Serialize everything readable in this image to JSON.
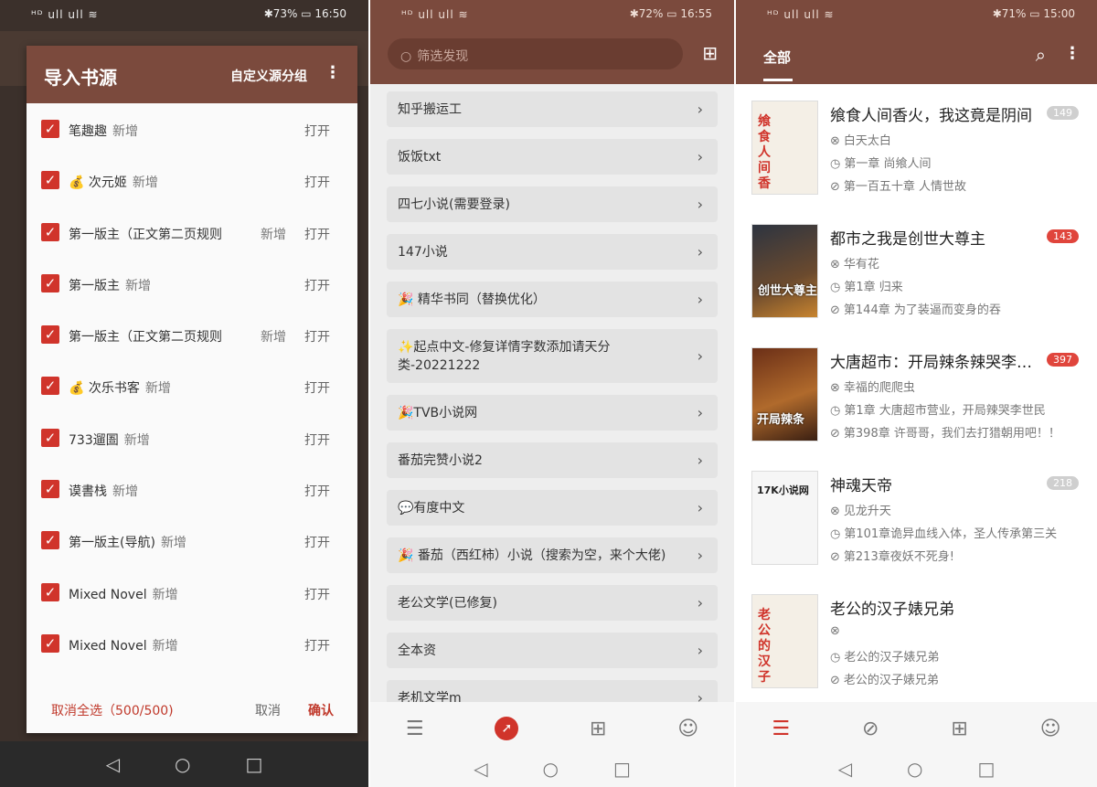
{
  "panel1": {
    "status": {
      "left": "ᴴᴰ ull ull ≋",
      "right": "✱73% ▭ 16:50"
    },
    "dialog": {
      "title": "导入书源",
      "custom_group": "自定义源分组",
      "menu_icon": "more-vertical-icon",
      "rows": [
        {
          "name": "笔趣趣",
          "tag": "新增",
          "open": "打开"
        },
        {
          "name": "💰 次元姬",
          "tag": "新增",
          "open": "打开"
        },
        {
          "name": "第一版主（正文第二页规则",
          "tag": "新增",
          "open": "打开"
        },
        {
          "name": "第一版主",
          "tag": "新增",
          "open": "打开"
        },
        {
          "name": "第一版主（正文第二页规则",
          "tag": "新增",
          "open": "打开"
        },
        {
          "name": "💰 次乐书客",
          "tag": "新增",
          "open": "打开"
        },
        {
          "name": "733遛圄",
          "tag": "新增",
          "open": "打开"
        },
        {
          "name": "谟書栈",
          "tag": "新增",
          "open": "打开"
        },
        {
          "name": "第一版主(导航)",
          "tag": "新增",
          "open": "打开"
        },
        {
          "name": "Mixed Novel",
          "tag": "新增",
          "open": "打开"
        },
        {
          "name": "Mixed Novel",
          "tag": "新增",
          "open": "打开"
        }
      ],
      "footer": {
        "deselect": "取消全选（500/500)",
        "cancel": "取消",
        "confirm": "确认"
      }
    },
    "nav": {
      "back": "◁",
      "home": "○",
      "recent": "□"
    }
  },
  "panel2": {
    "status": {
      "left": "ᴴᴰ ull ull ≋",
      "right": "✱72% ▭ 16:55"
    },
    "search_placeholder": "筛选发现",
    "group_icon": "group-icon",
    "sources": [
      "知乎搬运工",
      "饭饭txt",
      "四七小说(需要登录)",
      "147小说",
      "🎉 精华书同（替换优化）",
      "✨起点中文-修复详情字数添加请天分类-20221222",
      "🎉TVB小说网",
      "番茄完赞小说2",
      "💬有度中文",
      "🎉 番茄（西红柿）小说（搜索为空，来个大佬)",
      "老公文学(已修复)",
      "全本资",
      "老机文学m"
    ],
    "bottom_nav": [
      "bookshelf-icon",
      "explore-icon",
      "bookmark-icon",
      "profile-icon"
    ],
    "nav": {
      "back": "◁",
      "home": "○",
      "recent": "□"
    }
  },
  "panel3": {
    "status": {
      "left": "ᴴᴰ ull ull ≋",
      "right": "✱71% ▭ 15:00"
    },
    "tab": "全部",
    "books": [
      {
        "title": "飨食人间香火，我这竟是阴间",
        "cover": "飨食人间香",
        "author": "白天太白",
        "last_read": "第一章 尚飨人间",
        "latest": "第一百五十章 人情世故",
        "badge": "149",
        "badge_color": "#cfcfcf"
      },
      {
        "title": "都市之我是创世大尊主",
        "cover": "创世大尊主",
        "author": "华有花",
        "last_read": "第1章 归来",
        "latest": "第144章 为了装逼而变身的吞",
        "badge": "143",
        "badge_color": "#e0453c"
      },
      {
        "title": "大唐超市：开局辣条辣哭李…",
        "cover": "开局辣条",
        "author": "幸福的爬爬虫",
        "last_read": "第1章 大唐超市营业，开局辣哭李世民",
        "latest": "第398章 许哥哥，我们去打猎朝用吧！！",
        "badge": "397",
        "badge_color": "#e0453c"
      },
      {
        "title": "神魂天帝",
        "cover": "17K小说网",
        "author": "见龙升天",
        "last_read": "第101章诡异血线入体，圣人传承第三关",
        "latest": "第213章夜妖不死身!",
        "badge": "218",
        "badge_color": "#cfcfcf"
      },
      {
        "title": "老公的汉子婊兄弟",
        "cover": "老公的汉子",
        "author": "",
        "last_read": "老公的汉子婊兄弟",
        "latest": "老公的汉子婊兄弟",
        "badge": "",
        "badge_color": "#cfcfcf"
      }
    ],
    "nav": {
      "back": "◁",
      "home": "○",
      "recent": "□"
    }
  }
}
